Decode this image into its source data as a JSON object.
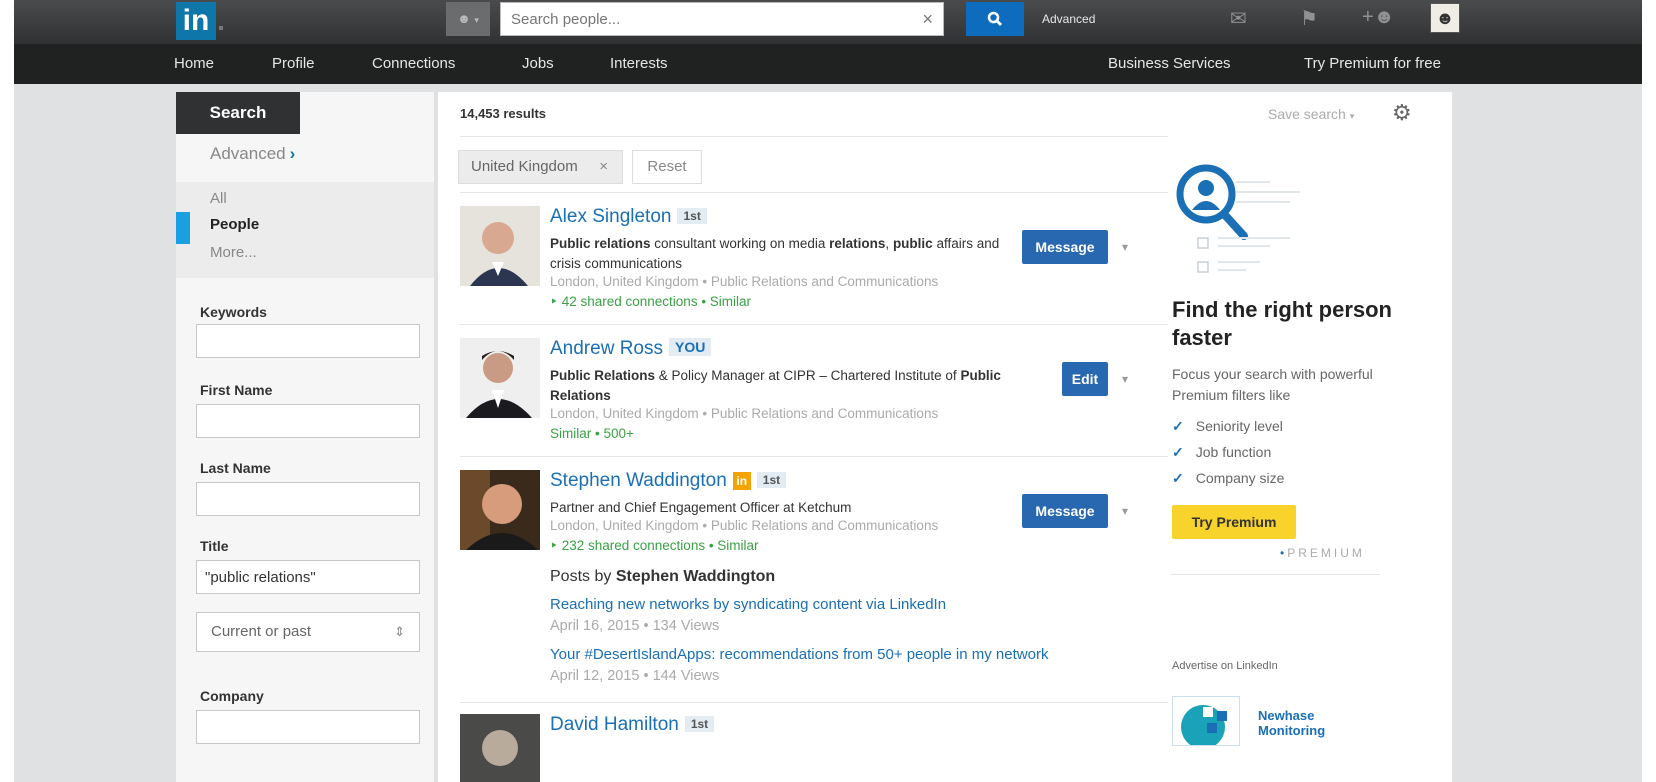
{
  "topbar": {
    "logo_text": "in",
    "search_placeholder": "Search people...",
    "search_clear": "×",
    "advanced_label": "Advanced",
    "icons": [
      "mail-icon",
      "flag-icon",
      "add-connection-icon",
      "profile-avatar"
    ]
  },
  "nav": {
    "items": [
      "Home",
      "Profile",
      "Connections",
      "Jobs",
      "Interests"
    ],
    "right_items": [
      "Business Services",
      "Try Premium for free"
    ]
  },
  "sidebar": {
    "search_tab": "Search",
    "advanced": "Advanced",
    "categories": [
      "All",
      "People",
      "More..."
    ],
    "fields": {
      "keywords_label": "Keywords",
      "first_name_label": "First Name",
      "last_name_label": "Last Name",
      "title_label": "Title",
      "title_value": "\"public relations\"",
      "title_scope": "Current or past",
      "company_label": "Company"
    }
  },
  "results": {
    "count": "14,453 results",
    "save_search": "Save search",
    "filter_chip": "United Kingdom",
    "reset": "Reset",
    "items": [
      {
        "name": "Alex Singleton",
        "degree": "1st",
        "headline_parts": [
          "Public relations",
          " consultant working on media ",
          "relations",
          ", ",
          "public",
          " affairs and crisis communications"
        ],
        "location": "London, United Kingdom • Public Relations and Communications",
        "shared": "42 shared connections • Similar",
        "action": "Message"
      },
      {
        "name": "Andrew Ross",
        "degree": "YOU",
        "headline_parts": [
          "Public Relations",
          " & Policy Manager at CIPR – Chartered Institute of ",
          "Public Relations"
        ],
        "location": "London, United Kingdom • Public Relations and Communications",
        "shared": "Similar • 500+",
        "action": "Edit"
      },
      {
        "name": "Stephen Waddington",
        "degree": "1st",
        "headline": "Partner and Chief Engagement Officer at Ketchum",
        "location": "London, United Kingdom • Public Relations and Communications",
        "shared": "232 shared connections • Similar",
        "action": "Message",
        "posts_prefix": "Posts by",
        "posts_author": "Stephen Waddington",
        "posts": [
          {
            "title": "Reaching new networks by syndicating content via LinkedIn",
            "meta": "April 16, 2015  •  134 Views"
          },
          {
            "title": "Your #DesertIslandApps: recommendations from 50+ people in my network",
            "meta": "April 12, 2015  •  144 Views"
          }
        ]
      },
      {
        "name": "David Hamilton",
        "degree": "1st"
      }
    ]
  },
  "promo": {
    "title": "Find the right person faster",
    "subtitle": "Focus your search with powerful Premium filters like",
    "checks": [
      "Seniority level",
      "Job function",
      "Company size"
    ],
    "button": "Try Premium",
    "premium_mark": "PREMIUM",
    "advertise": "Advertise on LinkedIn",
    "ad_name": "Newhase Monitoring"
  },
  "colors": {
    "brand_blue": "#0e76a8",
    "link_blue": "#1a6fb5",
    "button_blue": "#2868b0",
    "premium_yellow": "#f7d32b",
    "shared_green": "#3aa145"
  }
}
